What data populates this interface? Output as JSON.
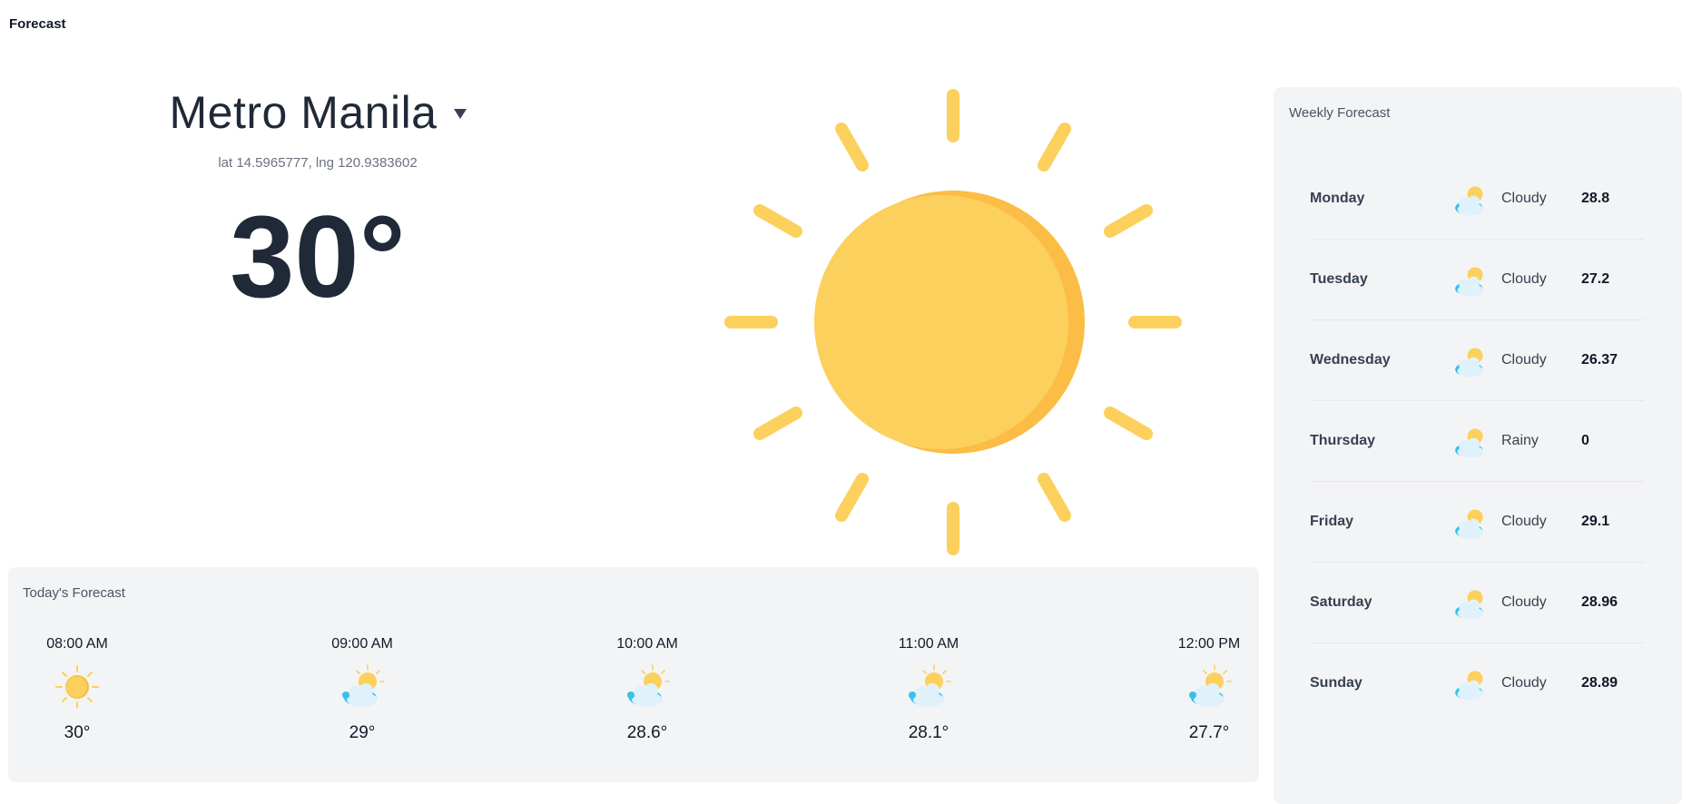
{
  "header": {
    "title": "Forecast"
  },
  "location": {
    "city": "Metro Manila",
    "coords": "lat 14.5965777, lng 120.9383602",
    "temperature": "30°",
    "main_icon": "sun-icon"
  },
  "today": {
    "title": "Today's Forecast",
    "hours": [
      {
        "time": "08:00 AM",
        "temp": "30°",
        "icon": "sun-icon"
      },
      {
        "time": "09:00 AM",
        "temp": "29°",
        "icon": "cloud-sun-icon"
      },
      {
        "time": "10:00 AM",
        "temp": "28.6°",
        "icon": "cloud-sun-icon"
      },
      {
        "time": "11:00 AM",
        "temp": "28.1°",
        "icon": "cloud-sun-icon"
      },
      {
        "time": "12:00 PM",
        "temp": "27.7°",
        "icon": "cloud-sun-icon"
      }
    ]
  },
  "weekly": {
    "title": "Weekly Forecast",
    "days": [
      {
        "day": "Monday",
        "condition": "Cloudy",
        "temp": "28.8",
        "icon": "cloud-sun-icon"
      },
      {
        "day": "Tuesday",
        "condition": "Cloudy",
        "temp": "27.2",
        "icon": "cloud-sun-icon"
      },
      {
        "day": "Wednesday",
        "condition": "Cloudy",
        "temp": "26.37",
        "icon": "cloud-sun-icon"
      },
      {
        "day": "Thursday",
        "condition": "Rainy",
        "temp": "0",
        "icon": "cloud-sun-icon"
      },
      {
        "day": "Friday",
        "condition": "Cloudy",
        "temp": "29.1",
        "icon": "cloud-sun-icon"
      },
      {
        "day": "Saturday",
        "condition": "Cloudy",
        "temp": "28.96",
        "icon": "cloud-sun-icon"
      },
      {
        "day": "Sunday",
        "condition": "Cloudy",
        "temp": "28.89",
        "icon": "cloud-sun-icon"
      }
    ]
  },
  "colors": {
    "sun": "#fcd05c",
    "sun_shade": "#fbbd45",
    "cloud": "#dff2fb",
    "cloud_dark": "#35c2ea",
    "panel": "#f3f4f6"
  }
}
